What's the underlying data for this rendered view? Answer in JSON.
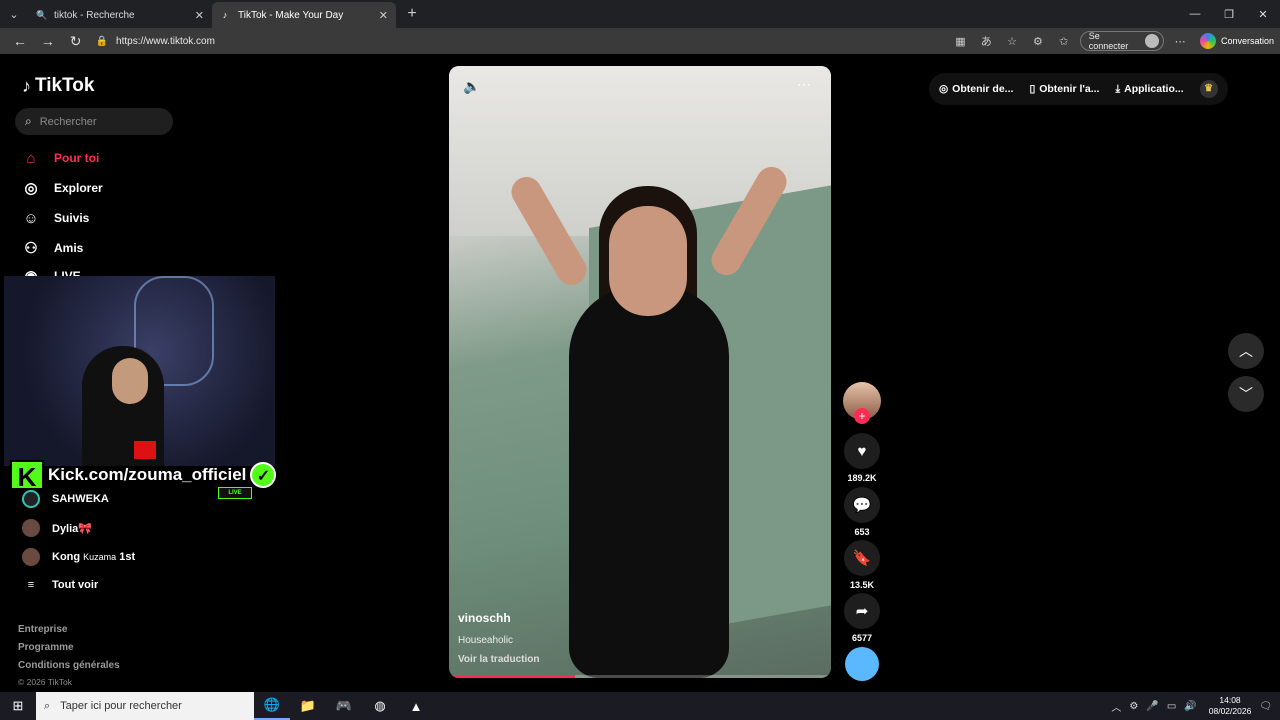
{
  "browser": {
    "tabs": [
      {
        "label": "tiktok - Recherche",
        "active": false
      },
      {
        "label": "TikTok - Make Your Day",
        "active": true
      }
    ],
    "url": "https://www.tiktok.com",
    "signin_label": "Se connecter",
    "conversation_label": "Conversation"
  },
  "sidebar": {
    "brand": "TikTok",
    "search_placeholder": "Rechercher",
    "nav": [
      {
        "label": "Pour toi",
        "icon": "home-icon",
        "active": true
      },
      {
        "label": "Explorer",
        "icon": "compass-icon",
        "active": false
      },
      {
        "label": "Suivis",
        "icon": "following-icon",
        "active": false
      },
      {
        "label": "Amis",
        "icon": "friends-icon",
        "active": false
      },
      {
        "label": "LIVE",
        "icon": "live-icon",
        "active": false
      }
    ],
    "following": [
      {
        "name": "SAHWEKA",
        "extra": ""
      },
      {
        "name": "Dylia🎀",
        "extra": ""
      },
      {
        "name": "Kong",
        "small": "Kuzama",
        "extra": "1st"
      }
    ],
    "see_all": "Tout voir",
    "footer_links": [
      "Entreprise",
      "Programme",
      "Conditions générales"
    ],
    "copyright": "© 2026 TikTok"
  },
  "overlay": {
    "kick_text": "Kick.com/zouma_officiel",
    "live_badge": "LIVE"
  },
  "video": {
    "username": "vinoschh",
    "description": "Houseaholic",
    "translate": "Voir la traduction",
    "progress": 0.33
  },
  "actions": {
    "likes": "189.2K",
    "comments": "653",
    "saves": "13.5K",
    "shares": "6577"
  },
  "topbar": {
    "items": [
      "Obtenir de...",
      "Obtenir l'a...",
      "Applicatio..."
    ]
  },
  "taskbar": {
    "search_placeholder": "Taper ici pour rechercher",
    "time": "14:08",
    "date": "08/02/2026"
  },
  "colors": {
    "accent": "#fe2c55",
    "kick_green": "#53fc18"
  }
}
